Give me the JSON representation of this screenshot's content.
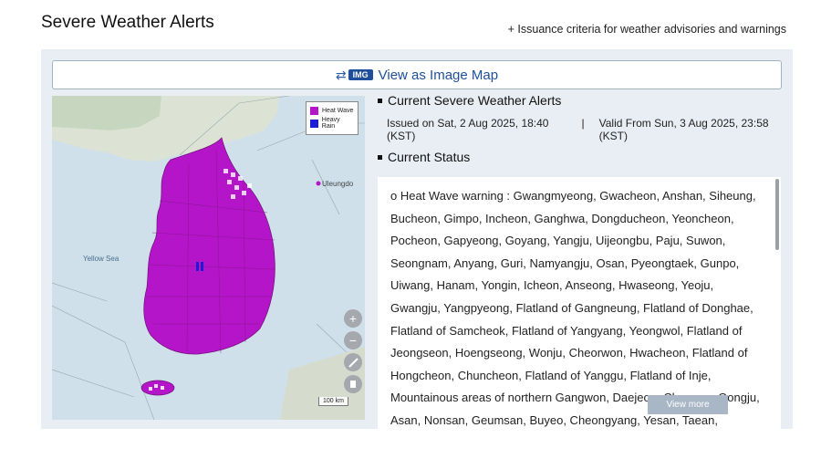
{
  "header": {
    "title": "Severe Weather Alerts",
    "criteria_link": "+ Issuance criteria for weather advisories and warnings"
  },
  "image_map_bar": {
    "badge": "IMG",
    "label": "View as Image Map"
  },
  "map": {
    "legend": [
      {
        "label": "Heat Wave",
        "color": "#b515c8"
      },
      {
        "label": "Heavy Rain",
        "color": "#1b1bd8"
      }
    ],
    "labels": {
      "sea": "Yellow Sea",
      "island": "Uleungdo"
    },
    "controls": {
      "zoom_in": "+",
      "zoom_out": "−"
    },
    "scale": "100 km"
  },
  "alerts": {
    "current_heading": "Current Severe Weather Alerts",
    "issued": "Issued on Sat, 2 Aug 2025, 18:40 (KST)",
    "separator": "|",
    "valid": "Valid From Sun, 3 Aug 2025, 23:58 (KST)",
    "status_heading": "Current Status",
    "status_text": "o Heat Wave warning : Gwangmyeong, Gwacheon, Anshan, Siheung, Bucheon, Gimpo, Incheon, Ganghwa, Dongducheon, Yeoncheon, Pocheon, Gapyeong, Goyang, Yangju, Uijeongbu, Paju, Suwon, Seongnam, Anyang, Guri, Namyangju, Osan, Pyeongtaek, Gunpo, Uiwang, Hanam, Yongin, Icheon, Anseong, Hwaseong, Yeoju, Gwangju, Yangpyeong, Flatland of Gangneung, Flatland of Donghae, Flatland of Samcheok, Flatland of Yangyang, Yeongwol, Flatland of Jeongseon, Hoengseong, Wonju, Cheorwon, Hwacheon, Flatland of Hongcheon, Chuncheon, Flatland of Yanggu, Flatland of Inje, Mountainous areas of northern Gangwon, Daejeon, Cheonan, Gongju, Asan, Nonsan, Geumsan, Buyeo, Cheongyang, Yesan, Taean, Dangjin, Seosan, Boryeong, Seocheon, Hongseong",
    "view_more": "View more"
  }
}
